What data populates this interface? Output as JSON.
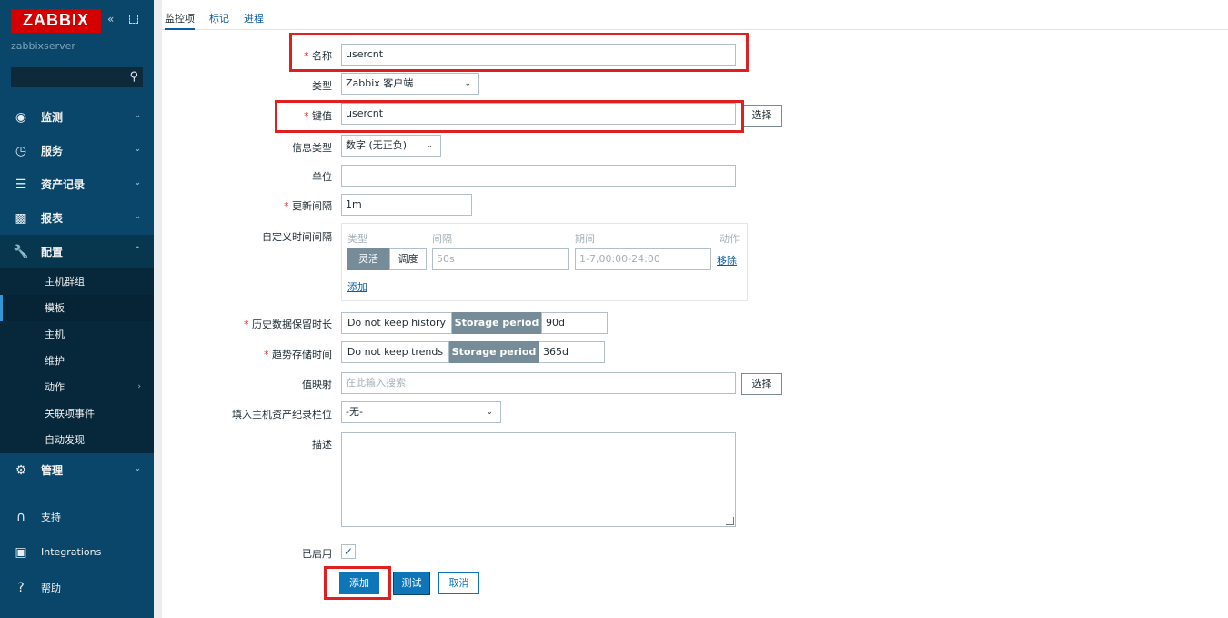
{
  "brand": {
    "logo": "ZABBIX",
    "server": "zabbixserver",
    "collapse_icon": "«"
  },
  "menu": {
    "monitoring": "监测",
    "services": "服务",
    "inventory": "资产记录",
    "reports": "报表",
    "configuration": "配置",
    "config_items": [
      "主机群组",
      "模板",
      "主机",
      "维护",
      "动作",
      "关联项事件",
      "自动发现"
    ],
    "administration": "管理",
    "support": "支持",
    "integrations": "Integrations",
    "help": "帮助"
  },
  "tabs": [
    "监控项",
    "标记",
    "进程"
  ],
  "form": {
    "name_label": "名称",
    "name_value": "usercnt",
    "type_label": "类型",
    "type_value": "Zabbix 客户端",
    "key_label": "键值",
    "key_value": "usercnt",
    "select_button": "选择",
    "info_type_label": "信息类型",
    "info_type_value": "数字 (无正负)",
    "units_label": "单位",
    "units_value": "",
    "interval_label": "更新间隔",
    "interval_value": "1m",
    "custom_label": "自定义时间间隔",
    "custom_headers": [
      "类型",
      "间隔",
      "期间",
      "动作"
    ],
    "custom_row": {
      "flexible": "灵活",
      "scheduling": "调度",
      "interval_placeholder": "50s",
      "period_placeholder": "1-7,00:00-24:00",
      "remove": "移除"
    },
    "add_link": "添加",
    "history_label": "历史数据保留时长",
    "history_off": "Do not keep history",
    "history_on": "Storage period",
    "history_value": "90d",
    "trends_label": "趋势存储时间",
    "trends_off": "Do not keep trends",
    "trends_on": "Storage period",
    "trends_value": "365d",
    "valuemap_label": "值映射",
    "valuemap_placeholder": "在此输入搜索",
    "valuemap_select": "选择",
    "inventory_label": "填入主机资产纪录栏位",
    "inventory_value": "-无-",
    "desc_label": "描述",
    "enabled_label": "已启用",
    "add_button": "添加",
    "test_button": "测试",
    "cancel_button": "取消"
  },
  "colors": {
    "sidebar": "#0a466a",
    "accent": "#0d75b8",
    "highlight": "#e02020"
  }
}
